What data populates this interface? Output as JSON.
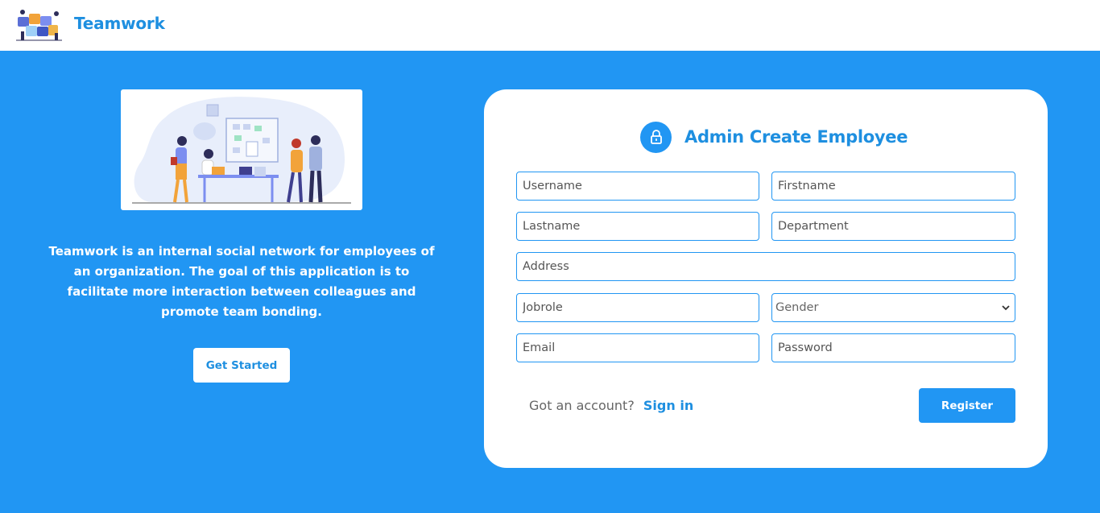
{
  "navbar": {
    "brand": "Teamwork",
    "logo_icon": "puzzle-team-logo"
  },
  "hero": {
    "illustration_icon": "team-meeting-illustration",
    "description": "Teamwork is an  internal social network for employees of an organization. The goal of this application is to facilitate more interaction between colleagues and promote team bonding.",
    "cta_label": "Get Started"
  },
  "form": {
    "title": "Admin Create Employee",
    "title_icon": "lock-icon",
    "fields": {
      "username": "Username",
      "firstname": "Firstname",
      "lastname": "Lastname",
      "department": "Department",
      "address": "Address",
      "jobrole": "Jobrole",
      "gender": "Gender",
      "email": "Email",
      "password": "Password"
    },
    "account_prompt": "Got an account?",
    "sign_in_label": "Sign in",
    "register_label": "Register"
  },
  "colors": {
    "primary": "#2196f3",
    "brand_text": "#1e8fe0",
    "background": "#2196f3",
    "card": "#ffffff"
  }
}
